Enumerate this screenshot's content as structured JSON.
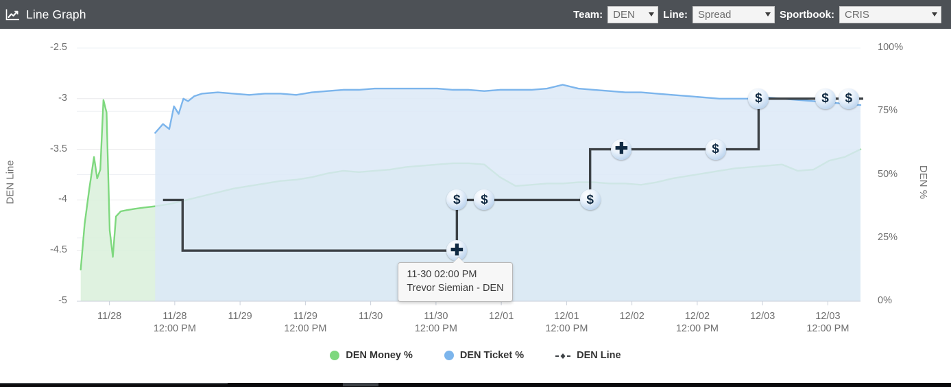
{
  "header": {
    "title": "Line Graph",
    "icon": "line-graph-icon",
    "controls": [
      {
        "label": "Team:",
        "value": "DEN",
        "name": "team"
      },
      {
        "label": "Line:",
        "value": "Spread",
        "name": "line"
      },
      {
        "label": "Sportbook:",
        "value": "CRIS",
        "name": "sportbook"
      }
    ]
  },
  "tooltip": {
    "time": "11-30 02:00 PM",
    "detail": "Trevor Siemian - DEN"
  },
  "colors": {
    "money_line": "#7ED87E",
    "money_fill": "#d9f0da",
    "ticket_line": "#7cb5ec",
    "ticket_fill": "#dce9f7",
    "den_line": "#3d4246",
    "header_bg": "#4d5156",
    "grid": "#e9e9ec",
    "axis_text": "#6f6f6f"
  },
  "chart_data": {
    "type": "line",
    "title": "Line Graph",
    "xlabel": "",
    "ylabel": "DEN Line",
    "y2label": "DEN %",
    "ylim": [
      -5,
      -2.5
    ],
    "y2lim": [
      0,
      100
    ],
    "grid": true,
    "legend_position": "bottom",
    "y_ticks": [
      "-2.5",
      "-3",
      "-3.5",
      "-4",
      "-4.5",
      "-5"
    ],
    "y_tick_values": [
      -2.5,
      -3,
      -3.5,
      -4,
      -4.5,
      -5
    ],
    "y2_ticks": [
      "100%",
      "75%",
      "50%",
      "25%",
      "0%"
    ],
    "y2_tick_values": [
      100,
      75,
      50,
      25,
      0
    ],
    "x_ticks": [
      {
        "date": "11/28",
        "time": ""
      },
      {
        "date": "11/28",
        "time": "12:00 PM"
      },
      {
        "date": "11/29",
        "time": ""
      },
      {
        "date": "11/29",
        "time": "12:00 PM"
      },
      {
        "date": "11/30",
        "time": ""
      },
      {
        "date": "11/30",
        "time": "12:00 PM"
      },
      {
        "date": "12/01",
        "time": ""
      },
      {
        "date": "12/01",
        "time": "12:00 PM"
      },
      {
        "date": "12/02",
        "time": ""
      },
      {
        "date": "12/02",
        "time": "12:00 PM"
      },
      {
        "date": "12/03",
        "time": ""
      },
      {
        "date": "12/03",
        "time": "12:00 PM"
      }
    ],
    "series": [
      {
        "name": "DEN Money %",
        "type": "area",
        "axis": "y2",
        "color": "#7ED87E",
        "fill": "#d9f0da",
        "x": [
          0.5,
          1.0,
          1.6,
          2.2,
          2.6,
          3.0,
          3.4,
          3.8,
          4.2,
          4.6,
          5.0,
          5.6,
          6.4,
          7.4,
          8.6,
          10.0,
          12.0,
          14.0,
          16.0,
          18.0,
          20.0,
          22.0,
          24.0,
          26.0,
          28.0,
          30.0,
          32.0,
          34.0,
          36.0,
          38.0,
          40.0,
          42.0,
          44.0,
          46.0,
          48.0,
          50.0,
          52.0,
          54.0,
          56.0,
          58.0,
          60.0,
          62.0,
          64.0,
          66.0,
          68.0,
          70.0,
          72.0,
          74.0,
          76.0,
          78.0,
          80.0,
          82.0,
          84.0,
          86.0,
          88.0,
          90.0,
          92.0,
          94.0,
          96.0,
          98.0,
          100.0
        ],
        "values": [
          12.5,
          30.5,
          44.5,
          57.0,
          48.5,
          52.0,
          79.5,
          74.5,
          28.0,
          17.5,
          33.5,
          35.5,
          36.0,
          36.5,
          37.0,
          37.5,
          38.5,
          40.0,
          41.5,
          43.0,
          44.5,
          45.5,
          46.5,
          47.5,
          48.0,
          49.0,
          50.5,
          51.5,
          51.0,
          51.5,
          52.0,
          53.0,
          53.5,
          54.0,
          54.5,
          54.5,
          54.0,
          49.0,
          45.5,
          46.0,
          46.5,
          46.5,
          47.0,
          47.0,
          46.5,
          46.5,
          46.0,
          47.0,
          48.5,
          49.5,
          50.5,
          51.5,
          52.5,
          53.0,
          53.5,
          54.0,
          51.5,
          52.0,
          55.5,
          57.0,
          60.0
        ]
      },
      {
        "name": "DEN Ticket %",
        "type": "area",
        "axis": "y2",
        "color": "#7cb5ec",
        "fill": "#dce9f7",
        "x": [
          10.0,
          11.0,
          11.8,
          12.4,
          13.0,
          13.6,
          14.2,
          15.0,
          16.0,
          18.0,
          20.0,
          22.0,
          24.0,
          26.0,
          28.0,
          30.0,
          32.0,
          34.0,
          36.0,
          38.0,
          40.0,
          42.0,
          44.0,
          46.0,
          48.0,
          50.0,
          52.0,
          54.0,
          56.0,
          58.0,
          60.0,
          62.0,
          64.0,
          66.0,
          68.0,
          70.0,
          72.0,
          74.0,
          76.0,
          78.0,
          80.0,
          82.0,
          84.0,
          86.0,
          88.0,
          90.0,
          92.0,
          94.0,
          96.0,
          98.0,
          100.0
        ],
        "values": [
          66.5,
          70.0,
          68.0,
          77.0,
          74.0,
          80.0,
          79.0,
          81.0,
          82.0,
          82.5,
          82.0,
          81.5,
          82.0,
          82.0,
          81.5,
          82.5,
          83.0,
          83.5,
          83.5,
          84.0,
          84.0,
          84.0,
          84.0,
          84.0,
          83.5,
          83.5,
          83.0,
          83.5,
          83.5,
          83.5,
          84.0,
          85.5,
          84.0,
          83.5,
          83.0,
          82.5,
          82.5,
          82.0,
          81.5,
          81.0,
          80.5,
          80.0,
          80.0,
          80.0,
          80.5,
          80.0,
          79.5,
          79.0,
          78.5,
          78.0,
          77.5
        ]
      },
      {
        "name": "DEN Line",
        "type": "step",
        "axis": "y1",
        "color": "#3d4246",
        "x": [
          11.0,
          13.5,
          13.5,
          48.5,
          48.5,
          65.5,
          65.5,
          87.0,
          87.0,
          100.0
        ],
        "values": [
          -4.0,
          -4.0,
          -4.5,
          -4.5,
          -4.0,
          -4.0,
          -3.5,
          -3.5,
          -3.0,
          -3.0
        ],
        "markers": [
          {
            "x": 48.5,
            "y": -4.5,
            "glyph": "plus",
            "label": "11-30 02:00 PM Trevor Siemian - DEN"
          },
          {
            "x": 48.5,
            "y": -4.0,
            "glyph": "dollar",
            "label": ""
          },
          {
            "x": 52.0,
            "y": -4.0,
            "glyph": "dollar",
            "label": ""
          },
          {
            "x": 65.5,
            "y": -4.0,
            "glyph": "dollar",
            "label": ""
          },
          {
            "x": 69.5,
            "y": -3.5,
            "glyph": "plus",
            "label": ""
          },
          {
            "x": 81.5,
            "y": -3.5,
            "glyph": "dollar",
            "label": ""
          },
          {
            "x": 87.0,
            "y": -3.0,
            "glyph": "dollar",
            "label": ""
          },
          {
            "x": 95.5,
            "y": -3.0,
            "glyph": "dollar",
            "label": ""
          },
          {
            "x": 98.5,
            "y": -3.0,
            "glyph": "dollar",
            "label": ""
          }
        ]
      }
    ],
    "legend": [
      {
        "label": "DEN Money %",
        "color": "#7ED87E",
        "symbol": "circle"
      },
      {
        "label": "DEN Ticket %",
        "color": "#7cb5ec",
        "symbol": "circle"
      },
      {
        "label": "DEN Line",
        "color": "#3d4246",
        "symbol": "dashed-diamond"
      }
    ]
  }
}
